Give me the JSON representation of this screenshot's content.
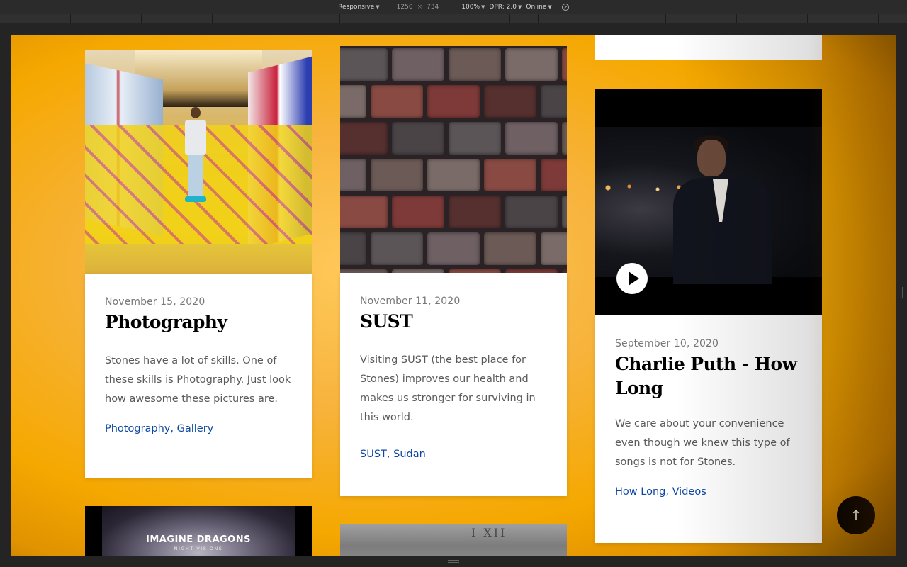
{
  "devtools": {
    "device": "Responsive",
    "width": "1250",
    "times": "×",
    "height": "734",
    "zoom": "100%",
    "dpr": "DPR: 2.0",
    "network": "Online"
  },
  "posts": [
    {
      "date": "November 15, 2020",
      "title": "Photography",
      "excerpt": "Stones have a lot of skills. One of these skills is Photography. Just look how awesome these pictures are.",
      "tags": [
        "Photography",
        "Gallery"
      ],
      "image_icon": "photo-mall-person"
    },
    {
      "date": "November 11, 2020",
      "title": "SUST",
      "excerpt": "Visiting SUST (the best place for Stones) improves our health and makes us stronger for surviving in this world.",
      "tags": [
        "SUST",
        "Sudan"
      ],
      "image_icon": "photo-bricks"
    },
    {
      "date": "September 10, 2020",
      "title": "Charlie Puth - How Long",
      "excerpt": "We care about your convenience even though we knew this type of songs is not for Stones.",
      "tags": [
        "How Long",
        "Videos"
      ],
      "image_icon": "video-thumbnail"
    }
  ],
  "teasers": {
    "album_band": "IMAGINE DRAGONS",
    "album_title": "NIGHT VISIONS",
    "stone_carving": "I XII"
  },
  "tag_separator": ", ",
  "scroll_top_icon": "↑",
  "colors": {
    "background": "#f5a800",
    "link": "#0d47a1",
    "card": "#ffffff"
  }
}
